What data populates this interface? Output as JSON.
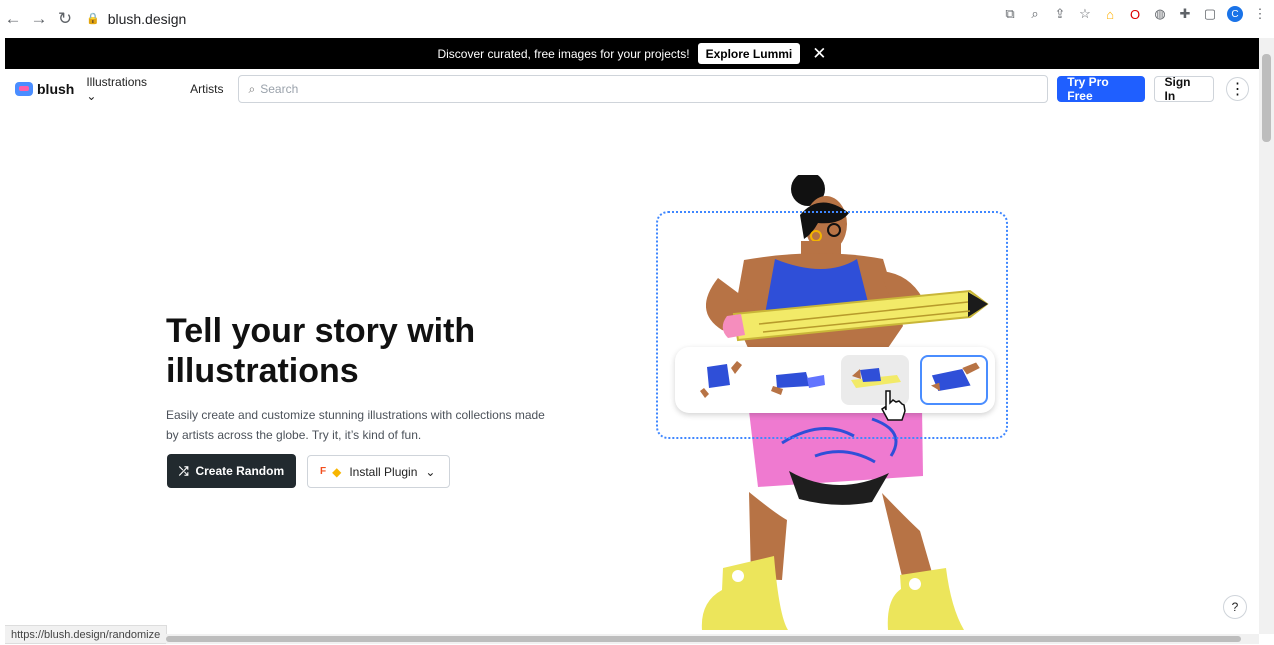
{
  "browser": {
    "url": "blush.design",
    "status_url": "https://blush.design/randomize",
    "avatar_letter": "C"
  },
  "banner": {
    "text": "Discover curated, free images for your projects!",
    "button": "Explore Lummi"
  },
  "nav": {
    "brand": "blush",
    "menu_illustrations": "Illustrations",
    "menu_artists": "Artists",
    "search_placeholder": "Search",
    "pro_button": "Try Pro Free",
    "sign_in": "Sign In"
  },
  "hero": {
    "title": "Tell your story with illustrations",
    "description": "Easily create and customize stunning illustrations with collections made by artists across the globe. Try it, it’s kind of fun.",
    "create_button": "Create Random",
    "install_button": "Install Plugin"
  },
  "help": {
    "label": "?"
  },
  "colors": {
    "primary": "#1f5fff",
    "dark_button": "#222a2f",
    "banner": "#000000"
  }
}
